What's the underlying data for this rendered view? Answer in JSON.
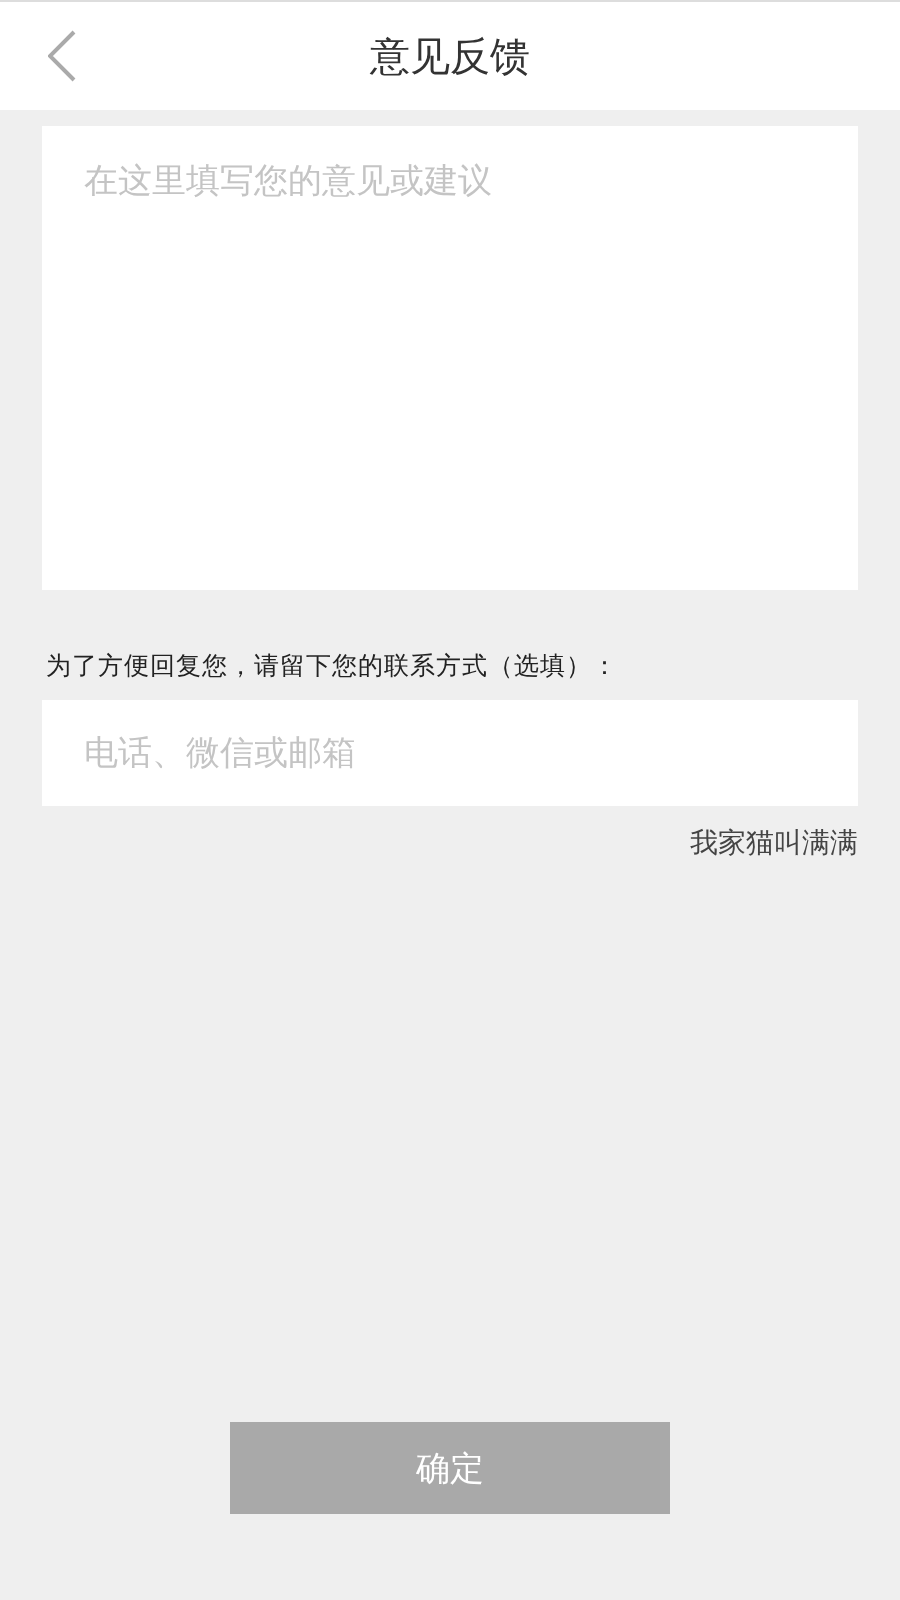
{
  "header": {
    "title": "意见反馈"
  },
  "feedback": {
    "placeholder": "在这里填写您的意见或建议"
  },
  "contact": {
    "label": "为了方便回复您，请留下您的联系方式（选填）：",
    "placeholder": "电话、微信或邮箱"
  },
  "user_name": "我家猫叫满满",
  "submit": {
    "label": "确定",
    "disabled": true
  }
}
